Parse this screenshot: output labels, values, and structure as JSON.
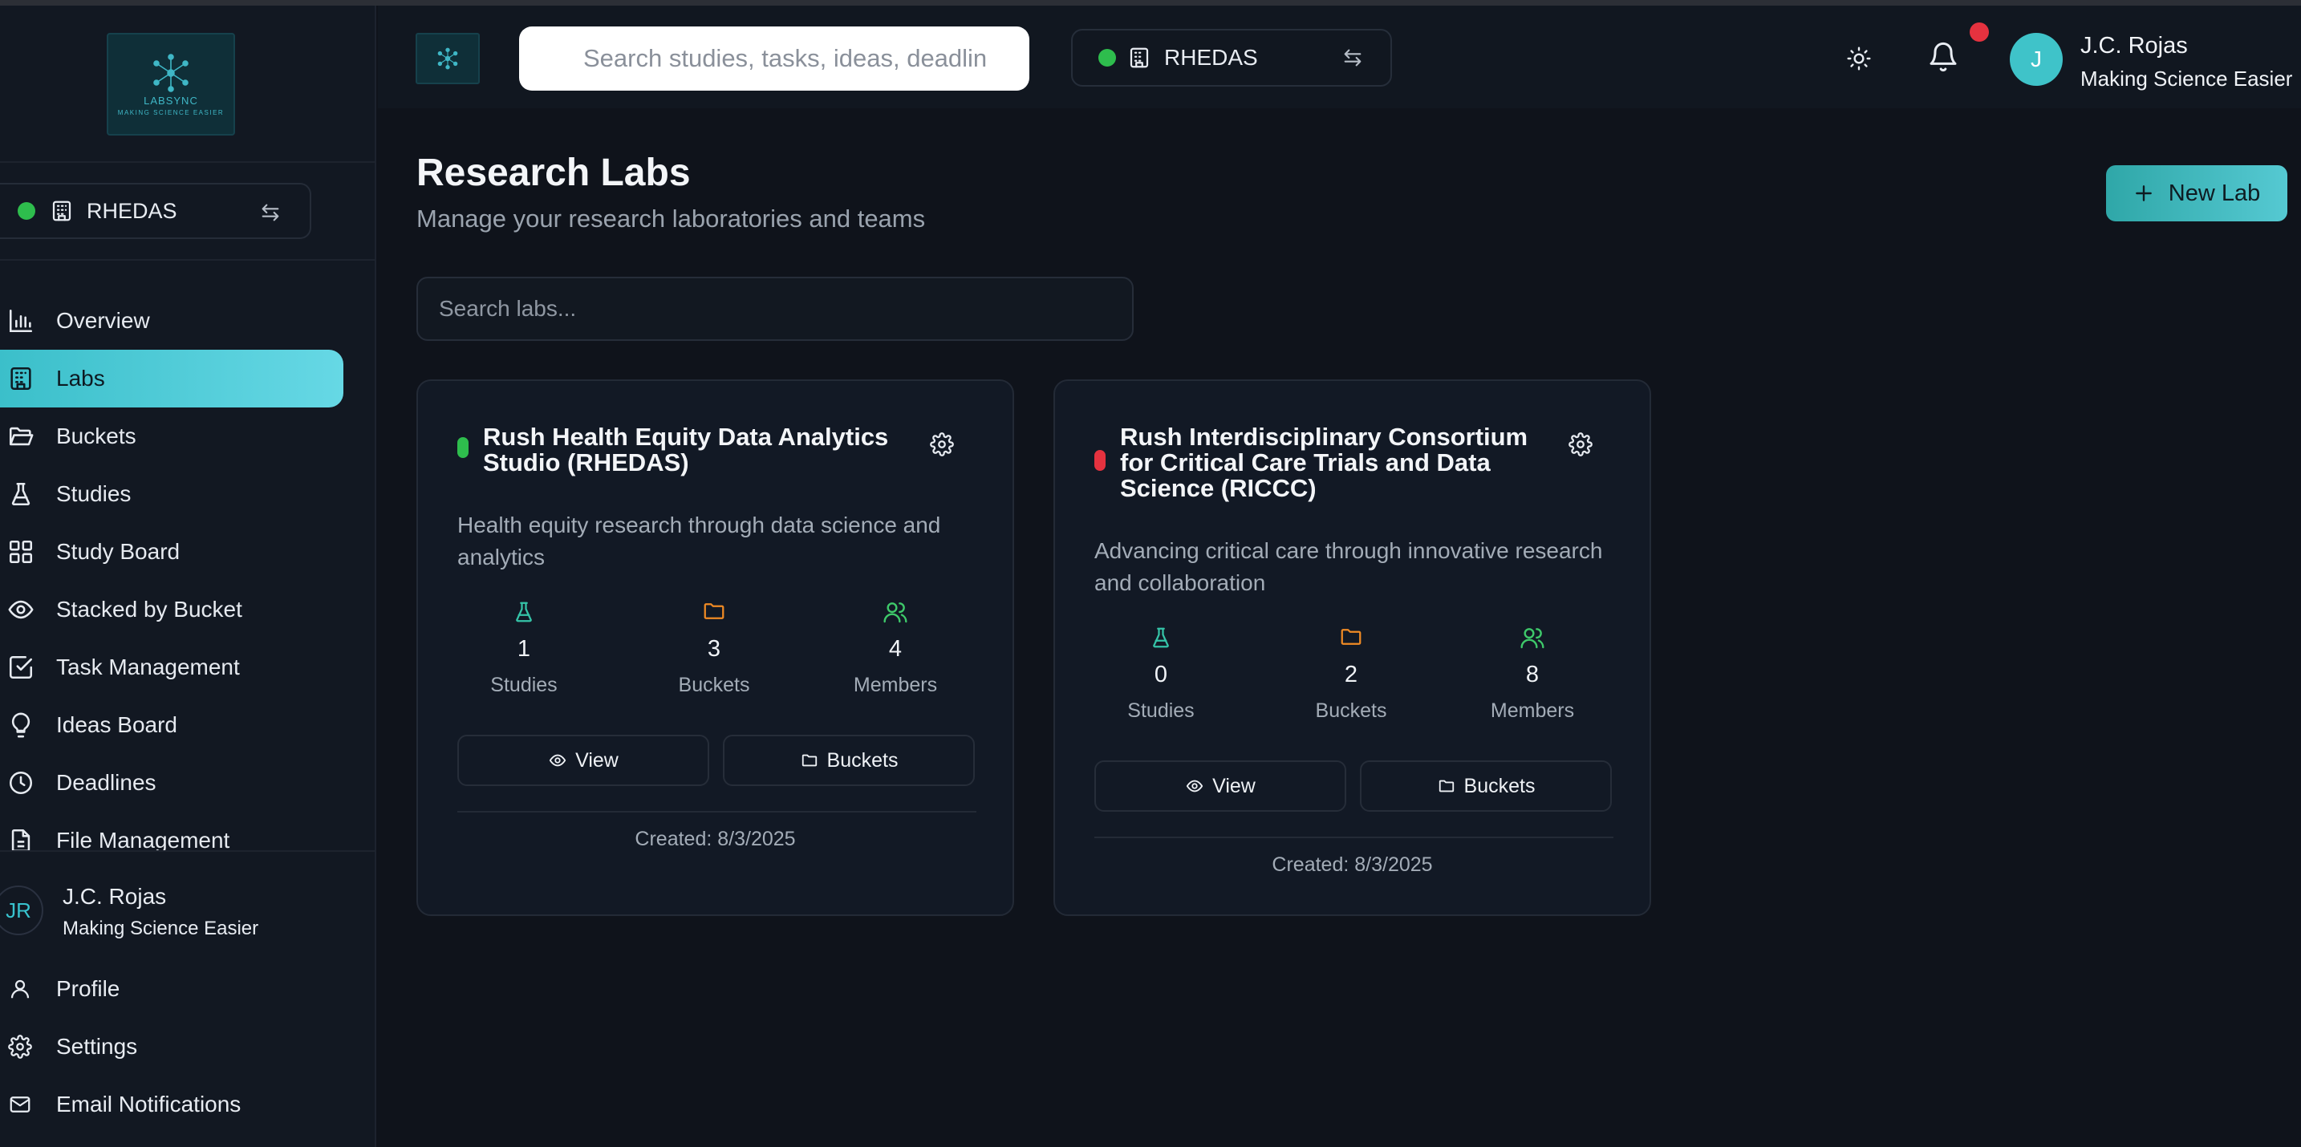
{
  "app": {
    "logo_text": "LABSYNC",
    "logo_tagline": "MAKING SCIENCE EASIER"
  },
  "header": {
    "search_placeholder": "Search studies, tasks, ideas, deadlin",
    "current_lab": "RHEDAS",
    "user_initial": "J",
    "user_name": "J.C. Rojas",
    "user_subtitle": "Making Science Easier"
  },
  "sidebar": {
    "current_lab": "RHEDAS",
    "items": [
      {
        "label": "Overview",
        "icon": "bar-chart-icon",
        "active": false
      },
      {
        "label": "Labs",
        "icon": "building-icon",
        "active": true
      },
      {
        "label": "Buckets",
        "icon": "folder-open-icon",
        "active": false
      },
      {
        "label": "Studies",
        "icon": "flask-icon",
        "active": false
      },
      {
        "label": "Study Board",
        "icon": "grid-icon",
        "active": false
      },
      {
        "label": "Stacked by Bucket",
        "icon": "eye-icon",
        "active": false
      },
      {
        "label": "Task Management",
        "icon": "check-square-icon",
        "active": false
      },
      {
        "label": "Ideas Board",
        "icon": "lightbulb-icon",
        "active": false
      },
      {
        "label": "Deadlines",
        "icon": "clock-icon",
        "active": false
      },
      {
        "label": "File Management",
        "icon": "file-icon",
        "active": false
      }
    ],
    "user": {
      "initials": "JR",
      "name": "J.C. Rojas",
      "subtitle": "Making Science Easier"
    },
    "bottom_items": [
      {
        "label": "Profile",
        "icon": "user-icon"
      },
      {
        "label": "Settings",
        "icon": "gear-icon"
      },
      {
        "label": "Email Notifications",
        "icon": "mail-icon"
      }
    ]
  },
  "main": {
    "title": "Research Labs",
    "subtitle": "Manage your research laboratories and teams",
    "new_lab_label": "New Lab",
    "search_placeholder": "Search labs...",
    "labs": [
      {
        "name": "Rush Health Equity Data Analytics Studio (RHEDAS)",
        "status_color": "#2ebd4d",
        "description": "Health equity research through data science and analytics",
        "studies": "1",
        "studies_label": "Studies",
        "buckets": "3",
        "buckets_label": "Buckets",
        "members": "4",
        "members_label": "Members",
        "view_label": "View",
        "buckets_button_label": "Buckets",
        "created": "Created: 8/3/2025"
      },
      {
        "name": "Rush Interdisciplinary Consortium for Critical Care Trials and Data Science (RICCC)",
        "status_color": "#e5323f",
        "description": "Advancing critical care through innovative research and collaboration",
        "studies": "0",
        "studies_label": "Studies",
        "buckets": "2",
        "buckets_label": "Buckets",
        "members": "8",
        "members_label": "Members",
        "view_label": "View",
        "buckets_button_label": "Buckets",
        "created": "Created: 8/3/2025"
      }
    ]
  },
  "colors": {
    "accent": "#3bbfca",
    "status_active": "#2ebd4d",
    "status_alert": "#e5323f",
    "studies_icon": "#35c4a8",
    "buckets_icon": "#f08a24",
    "members_icon": "#3ec96a"
  }
}
